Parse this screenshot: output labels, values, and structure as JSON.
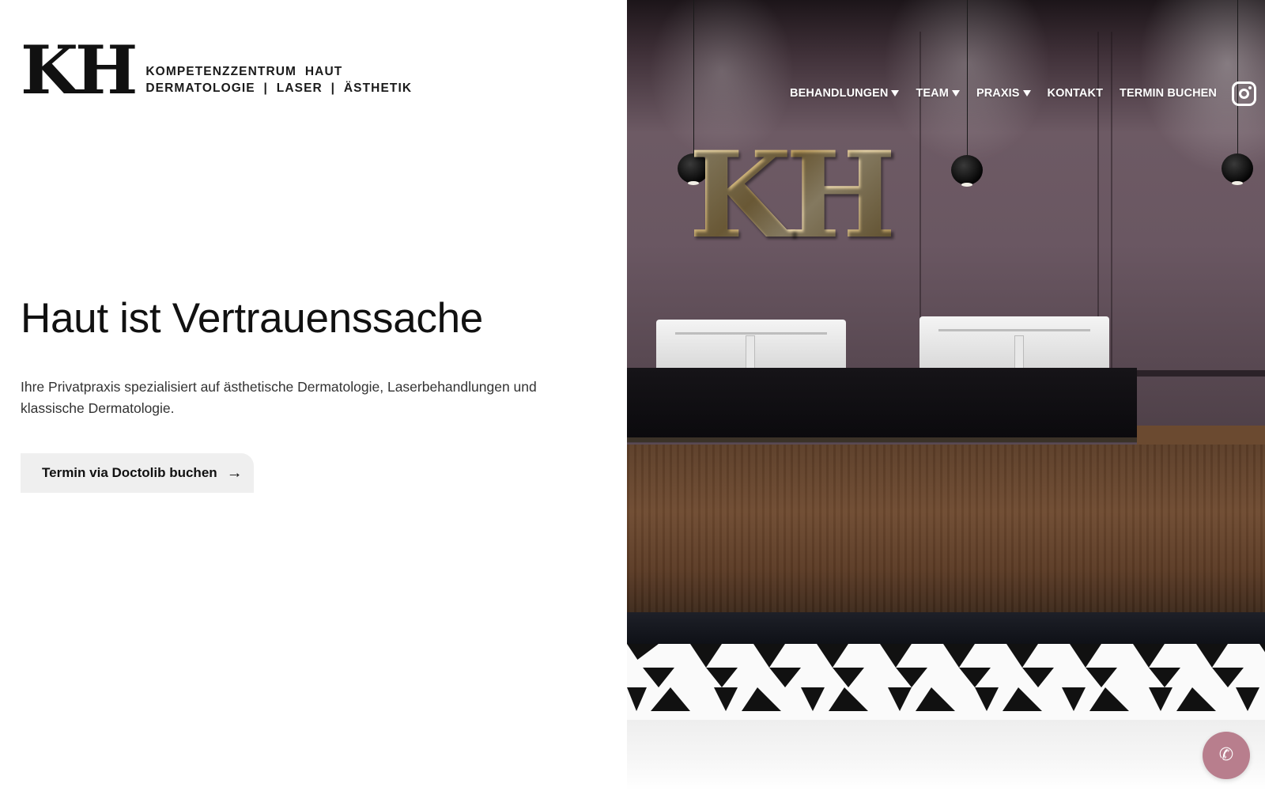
{
  "logo": {
    "mark": "KH",
    "line1": "KOMPETENZZENTRUM  HAUT",
    "line2": "DERMATOLOGIE  |  LASER  |  ÄSTHETIK"
  },
  "nav": {
    "items": [
      {
        "label": "BEHANDLUNGEN",
        "has_dropdown": true
      },
      {
        "label": "TEAM",
        "has_dropdown": true
      },
      {
        "label": "PRAXIS",
        "has_dropdown": true
      },
      {
        "label": "KONTAKT",
        "has_dropdown": false
      },
      {
        "label": "TERMIN BUCHEN",
        "has_dropdown": false
      }
    ],
    "social_icon": "instagram-icon"
  },
  "hero": {
    "title": "Haut ist Vertrauenssache",
    "subtitle": "Ihre Privatpraxis spezialisiert auf ästhetische Dermatologie, Laserbehandlungen und klassische Dermatologie.",
    "cta_label": "Termin via Doctolib buchen",
    "cta_arrow": "→"
  },
  "photo": {
    "sign_text": "KH"
  },
  "floating": {
    "phone_icon": "phone-icon",
    "phone_glyph": "✆",
    "color": "#b87e8d"
  }
}
